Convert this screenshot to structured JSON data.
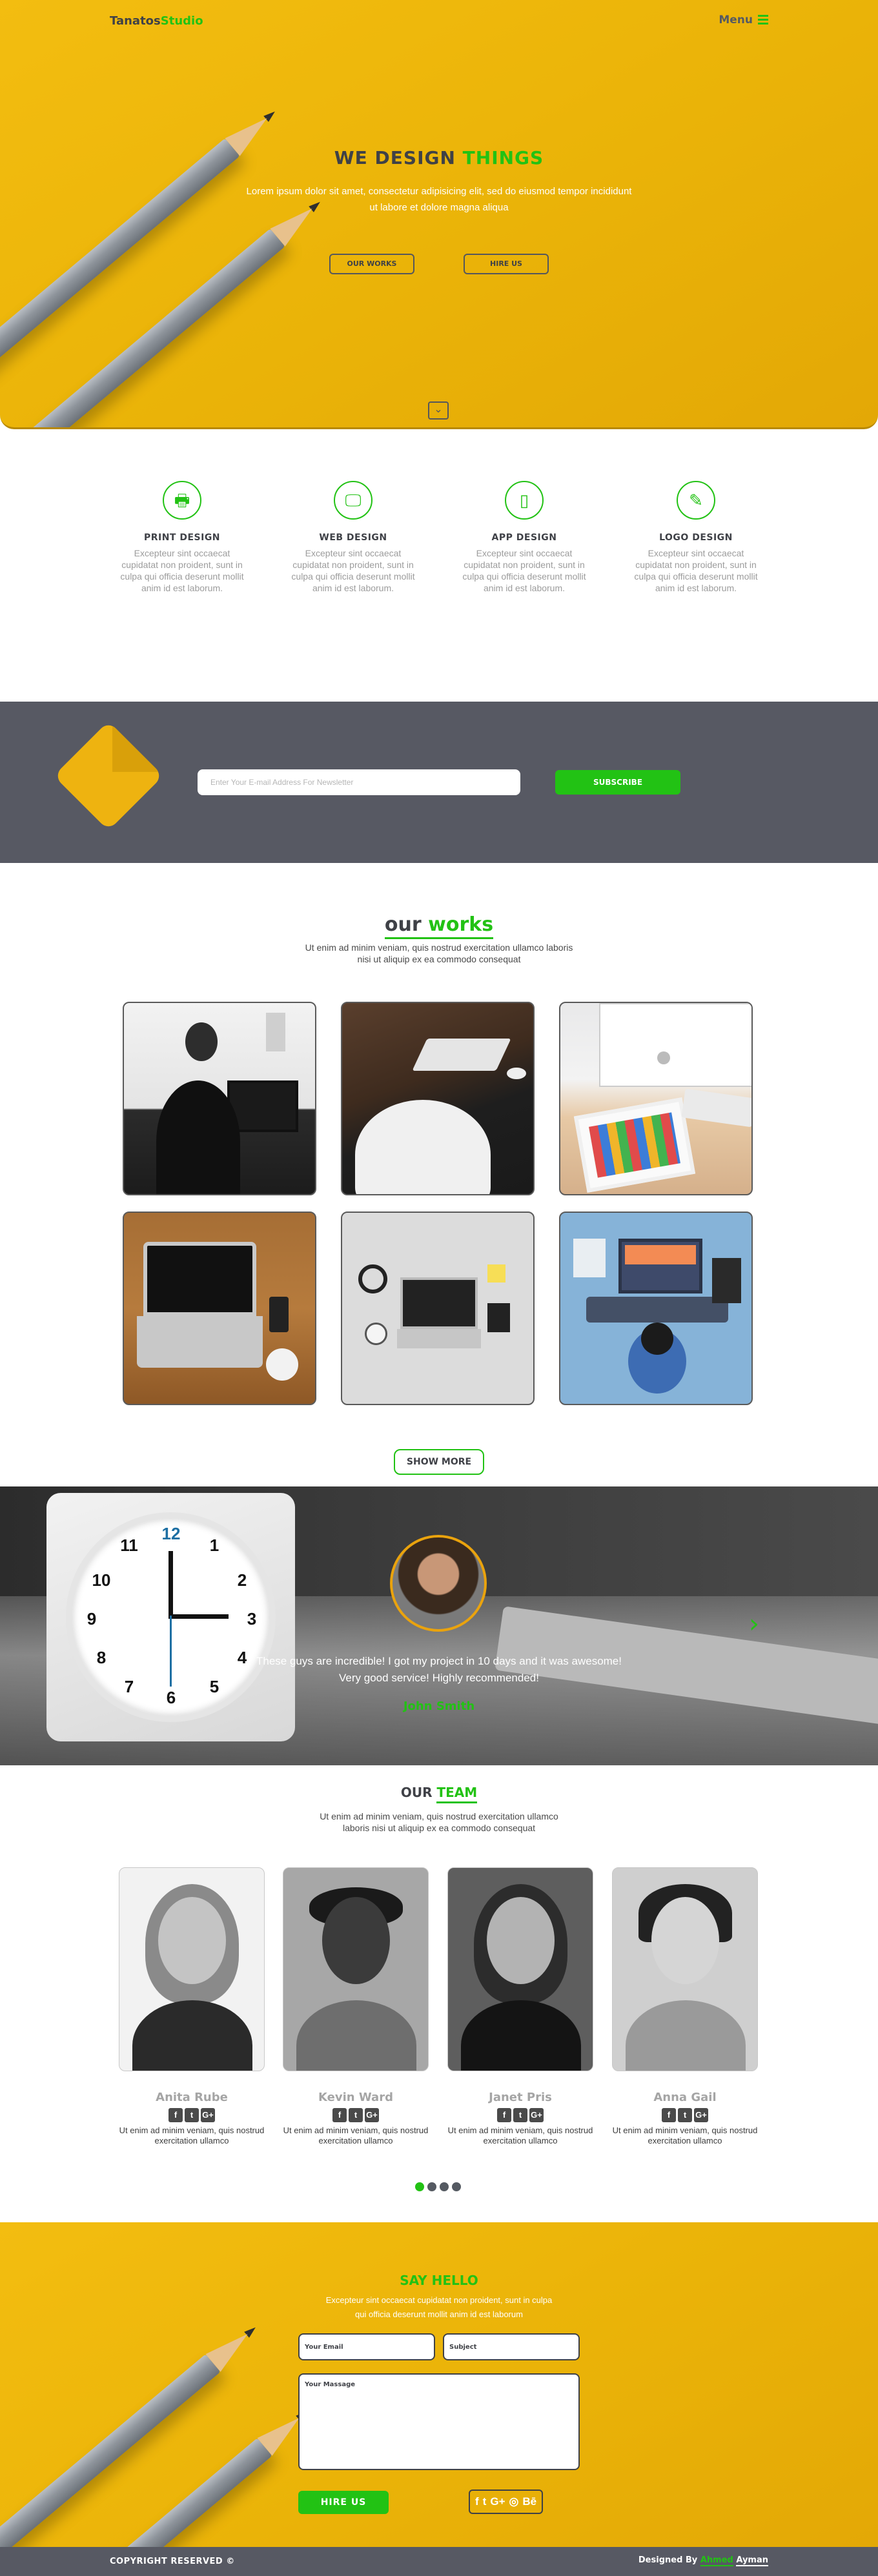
{
  "brand": {
    "part1": "Tanatos",
    "part2": "Studio"
  },
  "nav": {
    "menu_label": "Menu"
  },
  "hero": {
    "title_part1": "WE DESIGN",
    "title_part2": "THINGS",
    "text": "Lorem ipsum dolor sit amet, consectetur adipisicing elit, sed do eiusmod tempor incididunt ut labore et dolore magna aliqua",
    "btn_works": "OUR WORKS",
    "btn_hire": "HIRE US",
    "scroll_icon": "chevron-down-icon"
  },
  "services": [
    {
      "icon": "printer-icon",
      "glyph": "🖶",
      "title": "PRINT DESIGN",
      "text": "Excepteur sint occaecat cupidatat non proident, sunt in culpa qui officia deserunt mollit anim id est laborum."
    },
    {
      "icon": "monitor-icon",
      "glyph": "🖵",
      "title": "WEB DESIGN",
      "text": "Excepteur sint occaecat cupidatat non proident, sunt in culpa qui officia deserunt mollit anim id est laborum."
    },
    {
      "icon": "mobile-icon",
      "glyph": "▯",
      "title": "APP DESIGN",
      "text": "Excepteur sint occaecat cupidatat non proident, sunt in culpa qui officia deserunt mollit anim id est laborum."
    },
    {
      "icon": "pencil-icon",
      "glyph": "✎",
      "title": "LOGO DESIGN",
      "text": "Excepteur sint occaecat cupidatat non proident, sunt in culpa qui officia deserunt mollit anim id est laborum."
    }
  ],
  "newsletter": {
    "icon": "envelope-icon",
    "placeholder": "Enter Your E-mail Address For Newsletter",
    "button": "SUBSCRIBE"
  },
  "works": {
    "title_part1": "our",
    "title_part2": "works",
    "subtitle": "Ut enim ad minim veniam, quis nostrud exercitation ullamco laboris nisi ut aliquip ex ea commodo consequat",
    "button": "SHOW MORE"
  },
  "testimonial": {
    "quote_line1": "These guys are incredible! I got my project in 10 days and it was awesome!",
    "quote_line2": "Very good service! Highly recommended!",
    "name": "John Smith",
    "clock_numbers": [
      "12",
      "1",
      "2",
      "3",
      "4",
      "5",
      "6",
      "7",
      "8",
      "9",
      "10",
      "11"
    ],
    "next_icon": "chevron-right-icon"
  },
  "team": {
    "title_part1": "OUR",
    "title_part2": "TEAM",
    "subtitle_line1": "Ut enim ad minim veniam, quis nostrud exercitation ullamco",
    "subtitle_line2": "laboris nisi ut aliquip ex ea commodo consequat",
    "social_icons": [
      "f",
      "t",
      "G+"
    ],
    "members": [
      {
        "name": "Anita Rube",
        "text": "Ut enim ad minim veniam, quis nostrud exercitation ullamco"
      },
      {
        "name": "Kevin Ward",
        "text": "Ut enim ad minim veniam, quis nostrud exercitation ullamco"
      },
      {
        "name": "Janet Pris",
        "text": "Ut enim ad minim veniam, quis nostrud exercitation ullamco"
      },
      {
        "name": "Anna Gail",
        "text": "Ut enim ad minim veniam, quis nostrud exercitation ullamco"
      }
    ],
    "active_page": 1,
    "page_count": 4
  },
  "contact": {
    "title": "SAY HELLO",
    "text_line1": "Excepteur sint occaecat cupidatat non proident, sunt in culpa",
    "text_line2": "qui officia deserunt mollit anim id est laborum",
    "email_placeholder": "Your Email",
    "subject_placeholder": "Subject",
    "message_placeholder": "Your Massage",
    "button": "HIRE US",
    "social_icons": [
      "f",
      "t",
      "G+",
      "◎",
      "Bē"
    ]
  },
  "footer": {
    "copyright": "COPYRIGHT RESERVED ©",
    "credit_prefix": "Designed By",
    "credit_first": "Ahmed",
    "credit_last": "Ayman"
  },
  "colors": {
    "accent_green": "#22c214",
    "yellow": "#eab308",
    "slate": "#575963"
  }
}
